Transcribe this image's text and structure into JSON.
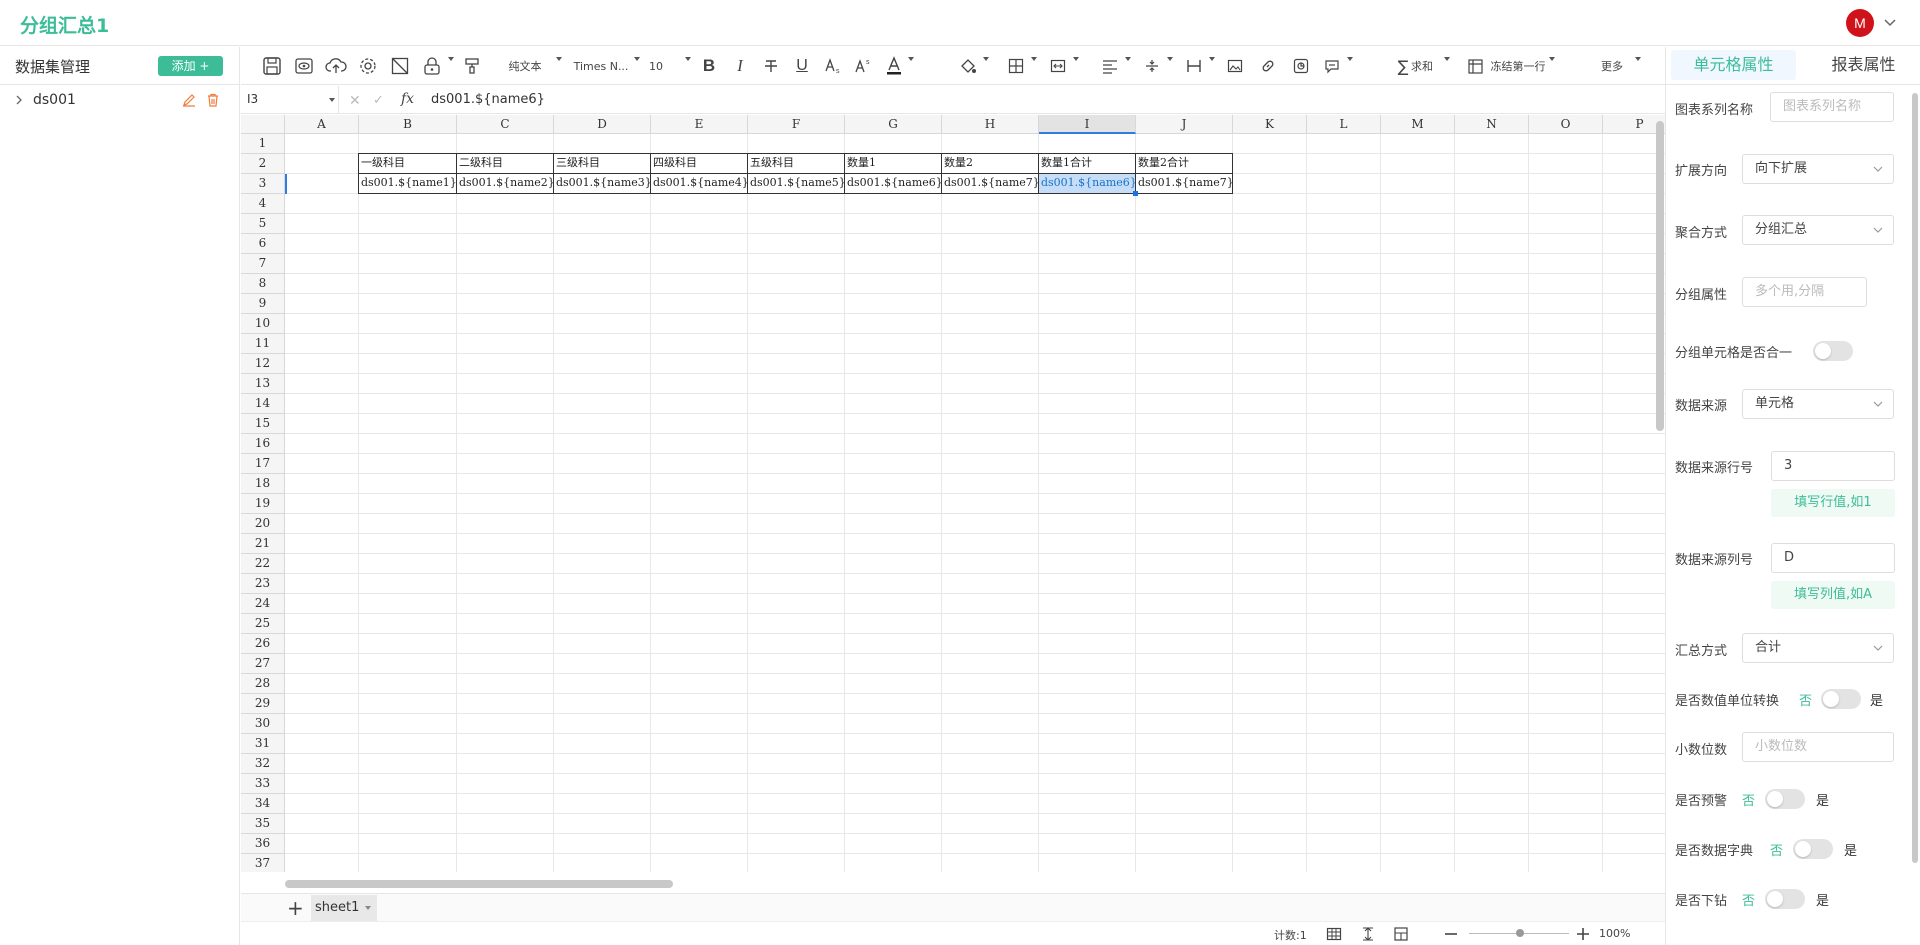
{
  "app": {
    "title": "分组汇总1",
    "avatar_letter": "M"
  },
  "sidebar": {
    "title": "数据集管理",
    "add_label": "添加 +",
    "datasets": [
      {
        "name": "ds001"
      }
    ]
  },
  "toolbar": {
    "items": [
      {
        "id": "save",
        "icon": "save-icon"
      },
      {
        "id": "preview",
        "icon": "eye-icon"
      },
      {
        "id": "upload",
        "icon": "cloud-upload-icon"
      },
      {
        "id": "settings",
        "icon": "gear-icon"
      },
      {
        "id": "clear",
        "icon": "clear-format-icon"
      },
      {
        "id": "lock",
        "icon": "lock-icon"
      },
      {
        "id": "format-painter",
        "icon": "paint-brush-icon"
      }
    ],
    "format_label": "纯文本",
    "font_label": "Times N...",
    "size_label": "10",
    "bold": "B",
    "italic": "I",
    "underline": "U",
    "sum_label": "求和",
    "freeze_label": "冻结第一行",
    "more_label": "更多"
  },
  "formula_bar": {
    "cell_ref": "I3",
    "fx": "fx",
    "formula": "ds001.${name6}"
  },
  "grid": {
    "columns": [
      "A",
      "B",
      "C",
      "D",
      "E",
      "F",
      "G",
      "H",
      "I",
      "J",
      "K",
      "L",
      "M",
      "N",
      "O",
      "P"
    ],
    "selected_column": "I",
    "rows_visible": 37,
    "header_row": [
      "一级科目",
      "二级科目",
      "三级科目",
      "四级科目",
      "五级科目",
      "数量1",
      "数量2",
      "数量1合计",
      "数量2合计"
    ],
    "data_row": [
      "ds001.${name1}",
      "ds001.${name2}",
      "ds001.${name3}",
      "ds001.${name4}",
      "ds001.${name5}",
      "ds001.${name6}",
      "ds001.${name7}",
      "ds001.${name6}",
      "ds001.${name7}"
    ]
  },
  "sheets": [
    {
      "name": "sheet1"
    }
  ],
  "status": {
    "count": "计数:1",
    "zoom": "100%"
  },
  "panel": {
    "tabs": {
      "cell": "单元格属性",
      "report": "报表属性"
    },
    "series_name": {
      "label": "图表系列名称",
      "placeholder": "图表系列名称"
    },
    "expand_dir": {
      "label": "扩展方向",
      "value": "向下扩展"
    },
    "aggregate": {
      "label": "聚合方式",
      "value": "分组汇总"
    },
    "group_attr": {
      "label": "分组属性",
      "placeholder": "多个用,分隔"
    },
    "merge_group": {
      "label": "分组单元格是否合一"
    },
    "data_source": {
      "label": "数据来源",
      "value": "单元格"
    },
    "source_row": {
      "label": "数据来源行号",
      "value": "3",
      "hint": "填写行值,如1"
    },
    "source_col": {
      "label": "数据来源列号",
      "value": "D",
      "hint": "填写列值,如A"
    },
    "summary": {
      "label": "汇总方式",
      "value": "合计"
    },
    "unit_convert": {
      "label": "是否数值单位转换",
      "no": "否",
      "yes": "是"
    },
    "decimals": {
      "label": "小数位数",
      "placeholder": "小数位数"
    },
    "warning": {
      "label": "是否预警",
      "no": "否",
      "yes": "是"
    },
    "dict": {
      "label": "是否数据字典",
      "no": "否",
      "yes": "是"
    },
    "drill": {
      "label": "是否下钻",
      "no": "否",
      "yes": "是"
    }
  }
}
